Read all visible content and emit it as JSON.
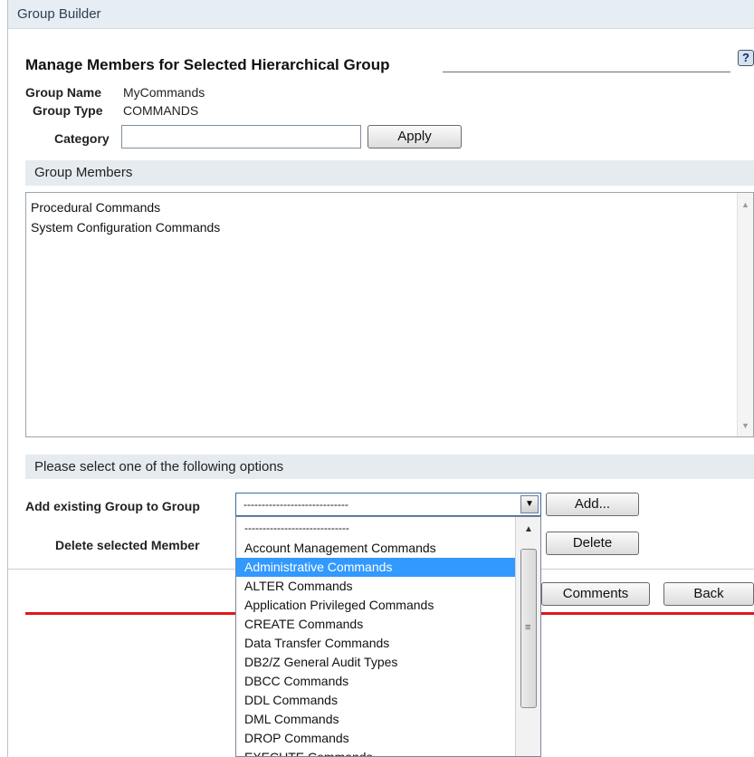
{
  "window": {
    "title": "Group Builder"
  },
  "header": {
    "heading": "Manage Members for Selected Hierarchical Group",
    "help_label": "?"
  },
  "group": {
    "name_label": "Group Name",
    "name_value": "MyCommands",
    "type_label": "Group Type",
    "type_value": "COMMANDS",
    "category_label": "Category",
    "category_value": "",
    "apply_label": "Apply"
  },
  "members": {
    "section_title": "Group Members",
    "items": [
      "Procedural Commands",
      "System Configuration Commands"
    ]
  },
  "options": {
    "section_title": "Please select one of the following options",
    "add_label": "Add existing Group to Group",
    "add_select_value": "-----------------------------",
    "add_button": "Add...",
    "delete_label": "Delete selected Member",
    "delete_button": "Delete"
  },
  "footer": {
    "comments_button": "Comments",
    "back_button": "Back"
  },
  "dropdown": {
    "items": [
      "-----------------------------",
      "Account Management Commands",
      "Administrative Commands",
      "ALTER Commands",
      "Application Privileged Commands",
      "CREATE Commands",
      "Data Transfer Commands",
      "DB2/Z General Audit Types",
      "DBCC Commands",
      "DDL Commands",
      "DML Commands",
      "DROP Commands",
      "EXECUTE Commands"
    ],
    "selected_index": 2
  },
  "colors": {
    "selection": "#3299ff",
    "accent_rule": "#e01818",
    "section_bg": "#e6ebf0"
  }
}
